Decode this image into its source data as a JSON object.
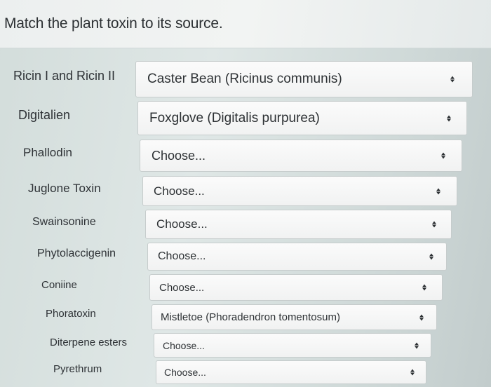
{
  "question": "Match the plant toxin to its source.",
  "rows": [
    {
      "toxin": "Ricin I and Ricin II",
      "selected": "Caster Bean (Ricinus communis)"
    },
    {
      "toxin": "Digitalien",
      "selected": "Foxglove (Digitalis purpurea)"
    },
    {
      "toxin": "Phallodin",
      "selected": "Choose..."
    },
    {
      "toxin": "Juglone Toxin",
      "selected": "Choose..."
    },
    {
      "toxin": "Swainsonine",
      "selected": "Choose..."
    },
    {
      "toxin": "Phytolaccigenin",
      "selected": "Choose..."
    },
    {
      "toxin": "Coniine",
      "selected": "Choose..."
    },
    {
      "toxin": "Phoratoxin",
      "selected": "Mistletoe (Phoradendron tomentosum)"
    },
    {
      "toxin": "Diterpene esters",
      "selected": "Choose..."
    },
    {
      "toxin": "Pyrethrum",
      "selected": "Choose..."
    }
  ],
  "icons": {
    "select_arrow": "updown-chevron-icon"
  }
}
